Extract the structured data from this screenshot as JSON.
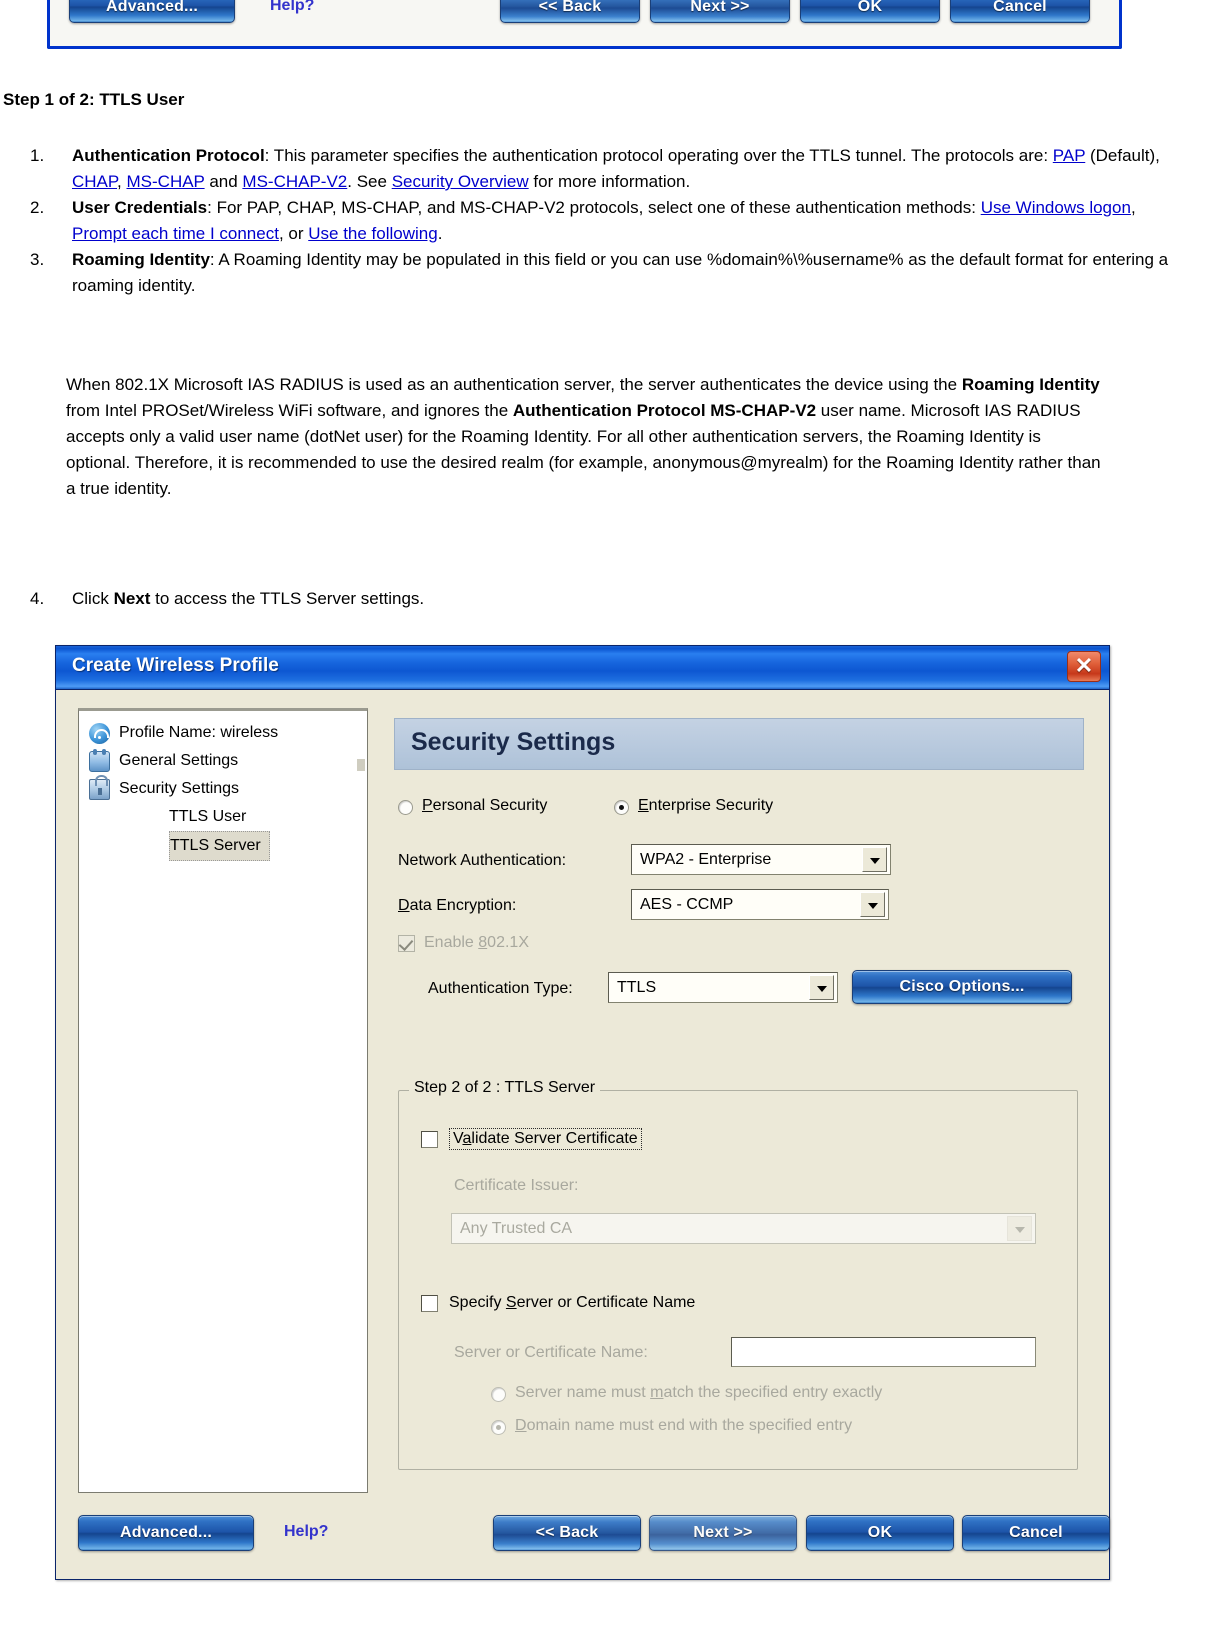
{
  "top_toolbar": {
    "advanced_label": "Advanced...",
    "advanced_accesskey": "v",
    "help_label": "Help?",
    "back_label": "<< Back",
    "next_label": "Next >>",
    "ok_label": "OK",
    "cancel_label": "Cancel"
  },
  "doc": {
    "heading": "Step 1 of 2: TTLS User",
    "items": [
      {
        "num": "1.",
        "term": "Authentication Protocol",
        "text_a": ": This parameter specifies the authentication protocol operating over the TTLS tunnel. The protocols are: ",
        "links": [
          "PAP",
          "CHAP",
          "MS-CHAP",
          "MS-CHAP-V2",
          "Security Overview"
        ],
        "text_b": " (Default), ",
        "text_c": " and ",
        "text_d": ". See ",
        "text_e": " for more information."
      },
      {
        "num": "2.",
        "term": "User Credentials",
        "text_a": ": For PAP, CHAP, MS-CHAP, and MS-CHAP-V2 protocols, select one of these authentication methods: ",
        "links": [
          "Use Windows logon",
          "Prompt each time I connect",
          "Use the following"
        ],
        "text_b": ", ",
        "text_c": ", or ",
        "text_d": "."
      },
      {
        "num": "3.",
        "term": "Roaming Identity",
        "text_a": ": A Roaming Identity may be populated in this field or you can use %domain%\\%username% as the default format for entering a roaming identity."
      }
    ],
    "note_paragraph": {
      "p1": "When 802.1X Microsoft IAS RADIUS is used as an authentication server, the server authenticates the device using the ",
      "b1": "Roaming Identity",
      "p2": " from Intel PROSet/Wireless WiFi software, and ignores the ",
      "b2": "Authentication Protocol MS-CHAP-V2",
      "p3": " user name. Microsoft IAS RADIUS accepts only a valid user name (dotNet user) for the Roaming Identity. For all other authentication servers, the Roaming Identity is optional. Therefore, it is recommended to use the desired realm (for example, anonymous@myrealm) for the Roaming Identity rather than a true identity."
    },
    "step4": {
      "num": "4.",
      "text_a": "Click ",
      "bold": "Next",
      "text_b": " to access the TTLS Server settings."
    }
  },
  "dialog": {
    "title": "Create Wireless Profile",
    "close_label": "✕",
    "tree": [
      {
        "label": "Profile Name: wireless",
        "icon": "wifi-icon",
        "level": 0,
        "selected": false
      },
      {
        "label": "General Settings",
        "icon": "adapter-icon",
        "level": 0,
        "selected": false
      },
      {
        "label": "Security Settings",
        "icon": "lock-icon",
        "level": 0,
        "selected": false
      },
      {
        "label": "TTLS User",
        "icon": "",
        "level": 1,
        "selected": false
      },
      {
        "label": "TTLS Server",
        "icon": "",
        "level": 1,
        "selected": true
      }
    ],
    "panel": {
      "header": "Security Settings",
      "personal_security_label": "Personal Security",
      "personal_security_accesskey": "P",
      "personal_security_selected": false,
      "enterprise_security_label": "Enterprise Security",
      "enterprise_security_accesskey": "E",
      "enterprise_security_selected": true,
      "network_auth_label": "Network Authentication:",
      "network_auth_value": "WPA2 - Enterprise",
      "data_encryption_label": "Data Encryption:",
      "data_encryption_accesskey": "D",
      "data_encryption_value": "AES - CCMP",
      "enable_8021x_label": "Enable 802.1X",
      "enable_8021x_checked": true,
      "enable_8021x_disabled": true,
      "auth_type_label": "Authentication Type:",
      "auth_type_value": "TTLS",
      "cisco_options_label": "Cisco Options...",
      "cisco_options_accesskey": "C",
      "fieldset_legend": "Step 2 of 2 : TTLS Server",
      "validate_cert_label": "Validate Server Certificate",
      "validate_cert_accesskey": "a",
      "validate_cert_checked": false,
      "validate_cert_focused": true,
      "cert_issuer_label": "Certificate Issuer:",
      "cert_issuer_value": "Any Trusted CA",
      "cert_issuer_disabled": true,
      "specify_server_label": "Specify Server or Certificate Name",
      "specify_server_accesskey": "S",
      "specify_server_checked": false,
      "server_name_label": "Server or Certificate Name:",
      "server_name_value": "",
      "server_name_disabled": true,
      "match_exactly_label": "Server name must match the specified entry exactly",
      "match_exactly_accesskey": "m",
      "match_exactly_selected": false,
      "domain_end_label": "Domain name must end with the specified entry",
      "domain_end_accesskey": "D",
      "domain_end_selected": true
    },
    "footer": {
      "advanced_label": "Advanced...",
      "advanced_accesskey": "v",
      "help_label": "Help?",
      "back_label": "<< Back",
      "next_label": "Next >>",
      "ok_label": "OK",
      "cancel_label": "Cancel"
    }
  },
  "colors": {
    "title_blue": "#1766de",
    "button_blue": "#1d54a8",
    "link_blue": "#0000cc",
    "dialog_face": "#ece9d8",
    "panel_header": "#b9cade",
    "close_red": "#c6381a"
  }
}
